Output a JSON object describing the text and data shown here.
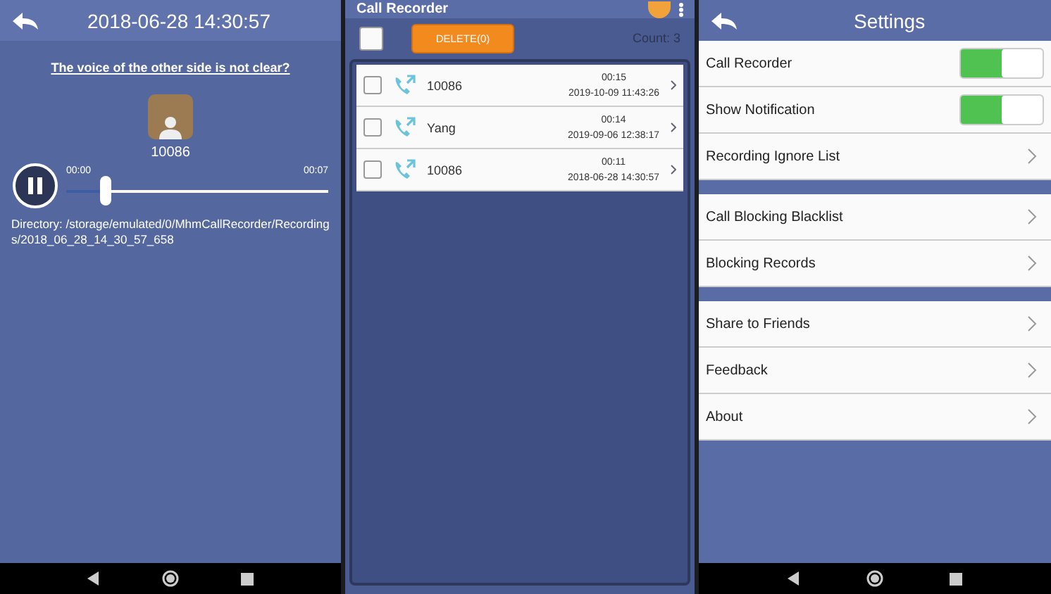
{
  "player": {
    "title": "2018-06-28 14:30:57",
    "help_link": "The voice of the other side is not clear?",
    "contact": "10086",
    "time_start": "00:00",
    "time_end": "00:07",
    "playing": true,
    "level": 0.15,
    "directory": "Directory: /storage/emulated/0/MhmCallRecorder/Recordings/2018_06_28_14_30_57_658"
  },
  "recorder": {
    "title": "Call Recorder",
    "select_all_checked": false,
    "delete_button": "DELETE(0)",
    "count": "Count: 3",
    "calls": [
      {
        "name": "10086",
        "duration": "00:15",
        "date": "2019-10-09 11:43:26",
        "checked": false
      },
      {
        "name": "Yang",
        "duration": "00:14",
        "date": "2019-09-06 12:38:17",
        "checked": false
      },
      {
        "name": "10086",
        "duration": "00:11",
        "date": "2018-06-28 14:30:57",
        "checked": false
      }
    ]
  },
  "settings": {
    "title": "Settings",
    "groups": [
      {
        "items": [
          {
            "label": "Call Recorder",
            "kind": "toggle",
            "on": true
          },
          {
            "label": "Show Notification",
            "kind": "toggle",
            "on": true
          },
          {
            "label": "Recording Ignore List",
            "kind": "link"
          }
        ]
      },
      {
        "items": [
          {
            "label": "Call Blocking Blacklist",
            "kind": "link"
          },
          {
            "label": "Blocking Records",
            "kind": "link"
          }
        ]
      },
      {
        "items": [
          {
            "label": "Share to Friends",
            "kind": "link"
          },
          {
            "label": "Feedback",
            "kind": "link"
          },
          {
            "label": "About",
            "kind": "link"
          }
        ]
      }
    ]
  }
}
